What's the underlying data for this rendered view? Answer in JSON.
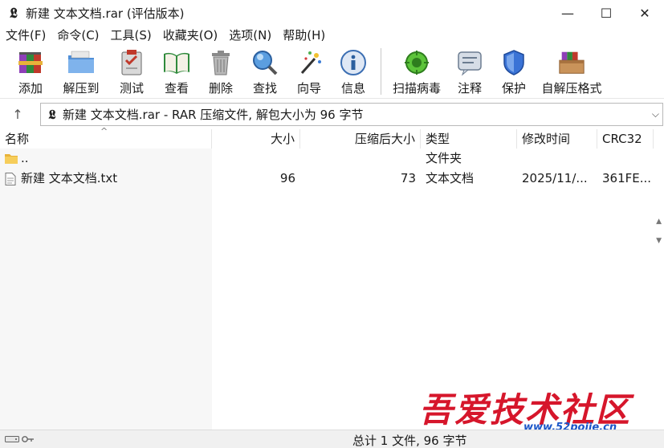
{
  "window": {
    "title": "新建 文本文档.rar (评估版本)",
    "minimize": "—",
    "maximize": "☐",
    "close": "✕"
  },
  "menu": [
    "文件(F)",
    "命令(C)",
    "工具(S)",
    "收藏夹(O)",
    "选项(N)",
    "帮助(H)"
  ],
  "toolbar": [
    {
      "label": "添加",
      "icon": "add-archive-icon"
    },
    {
      "label": "解压到",
      "icon": "extract-folder-icon"
    },
    {
      "label": "测试",
      "icon": "test-clipboard-icon"
    },
    {
      "label": "查看",
      "icon": "view-book-icon"
    },
    {
      "label": "删除",
      "icon": "delete-trash-icon"
    },
    {
      "label": "查找",
      "icon": "find-magnifier-icon"
    },
    {
      "label": "向导",
      "icon": "wizard-wand-icon"
    },
    {
      "label": "信息",
      "icon": "info-icon"
    },
    {
      "label": "扫描病毒",
      "icon": "virus-scan-icon"
    },
    {
      "label": "注释",
      "icon": "comment-icon"
    },
    {
      "label": "保护",
      "icon": "shield-icon"
    },
    {
      "label": "自解压格式",
      "icon": "sfx-box-icon"
    }
  ],
  "address": {
    "up": "↑",
    "text": "新建 文本文档.rar - RAR 压缩文件, 解包大小为 96 字节",
    "dropdown": "⌵"
  },
  "columns": {
    "name": "名称",
    "size": "大小",
    "packed": "压缩后大小",
    "type": "类型",
    "modified": "修改时间",
    "crc": "CRC32"
  },
  "rows": [
    {
      "name": "..",
      "size": "",
      "packed": "",
      "type": "文件夹",
      "modified": "",
      "crc": "",
      "icon": "folder-icon"
    },
    {
      "name": "新建 文本文档.txt",
      "size": "96",
      "packed": "73",
      "type": "文本文档",
      "modified": "2025/11/...",
      "crc": "361FE...",
      "icon": "text-file-icon"
    }
  ],
  "status": {
    "text": "总计 1 文件, 96 字节"
  },
  "watermark": {
    "big": "吾爱技术社区",
    "url": "www.52pojie.cn"
  },
  "colors": {
    "watermark_red": "#d6162b",
    "watermark_blue": "#1a55c8"
  }
}
